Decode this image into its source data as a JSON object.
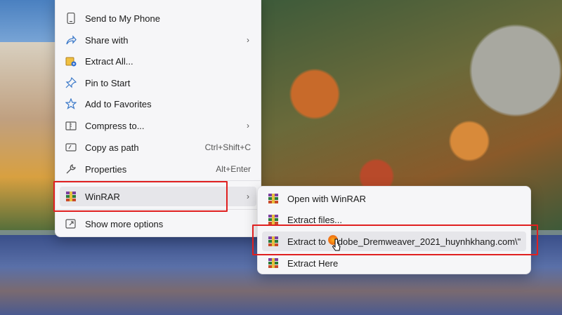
{
  "main_menu": {
    "items": [
      {
        "label": "Send to My Phone",
        "icon": "phone-icon"
      },
      {
        "label": "Share with",
        "icon": "share-icon",
        "submenu": true
      },
      {
        "label": "Extract All...",
        "icon": "extract-all-icon"
      },
      {
        "label": "Pin to Start",
        "icon": "pin-icon"
      },
      {
        "label": "Add to Favorites",
        "icon": "star-icon"
      },
      {
        "label": "Compress to...",
        "icon": "compress-icon",
        "submenu": true
      },
      {
        "label": "Copy as path",
        "icon": "copy-path-icon",
        "shortcut": "Ctrl+Shift+C"
      },
      {
        "label": "Properties",
        "icon": "wrench-icon",
        "shortcut": "Alt+Enter"
      },
      {
        "label": "WinRAR",
        "icon": "winrar-icon",
        "submenu": true
      },
      {
        "label": "Show more options",
        "icon": "more-options-icon"
      }
    ]
  },
  "winrar_submenu": {
    "items": [
      {
        "label": "Open with WinRAR"
      },
      {
        "label": "Extract files..."
      },
      {
        "label": "Extract to \"Adobe_Dremweaver_2021_huynhkhang.com\\\""
      },
      {
        "label": "Extract Here"
      }
    ]
  },
  "colors": {
    "highlight": "#e02020",
    "menu_bg": "#f6f6f8"
  }
}
